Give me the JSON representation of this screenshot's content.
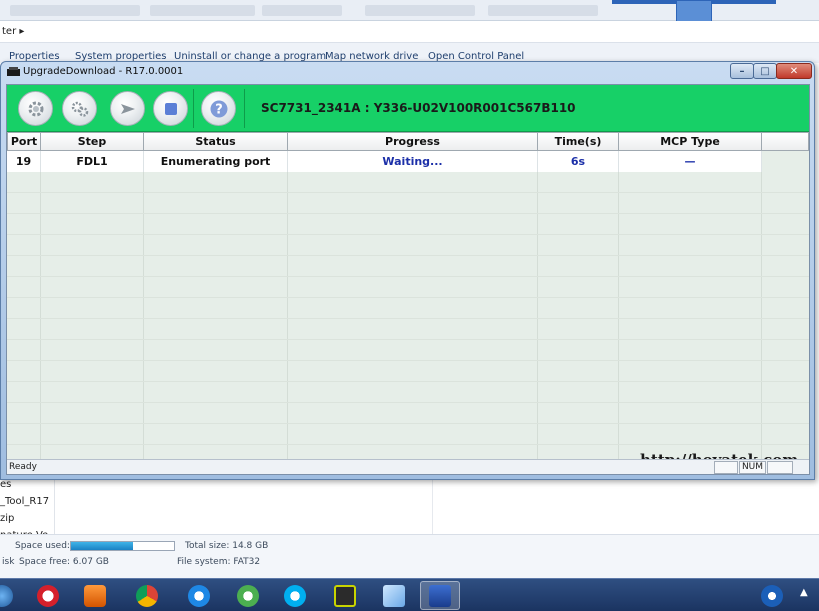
{
  "explorer": {
    "address_fragment": "ter ▸",
    "menu": [
      "Properties",
      "System properties",
      "Uninstall or change a program",
      "Map network drive",
      "Open Control Panel"
    ],
    "file_names": [
      "es",
      "_Tool_R17",
      "zip",
      "nature Ve"
    ],
    "details": {
      "space_used_label": "Space used:",
      "space_used_fraction": 0.6,
      "space_free_prefix": "isk",
      "space_free": "Space free: 6.07 GB",
      "total_size": "Total size: 14.8 GB",
      "file_system": "File system: FAT32"
    }
  },
  "window": {
    "title": "UpgradeDownload - R17.0.0001",
    "minimize": "–",
    "maximize": "□",
    "close": "✕"
  },
  "toolbar": {
    "icons": [
      "gear-icon",
      "gears-icon",
      "play-icon",
      "stop-icon",
      "help-icon"
    ],
    "firmware": "SC7731_2341A : Y336-U02V100R001C567B110"
  },
  "table": {
    "columns": [
      "Port",
      "Step",
      "Status",
      "Progress",
      "Time(s)",
      "MCP Type"
    ],
    "rows": [
      {
        "port": "19",
        "step": "FDL1",
        "status": "Enumerating port",
        "progress": "Waiting...",
        "time": "6s",
        "mcp": "—"
      }
    ]
  },
  "watermark": "http://hovatek.com",
  "status": {
    "text": "Ready",
    "num": "NUM"
  },
  "taskbar": {
    "apps": [
      "opera-icon",
      "media-player-icon",
      "chrome-icon",
      "ie-icon",
      "utorrent-icon",
      "skype-icon",
      "app-icon",
      "notes-icon",
      "upgrade-download-icon"
    ],
    "tray_chevron": "▲"
  },
  "colors": {
    "toolbar_green": "#17d067",
    "progress_blue": "#1b2fa8"
  }
}
